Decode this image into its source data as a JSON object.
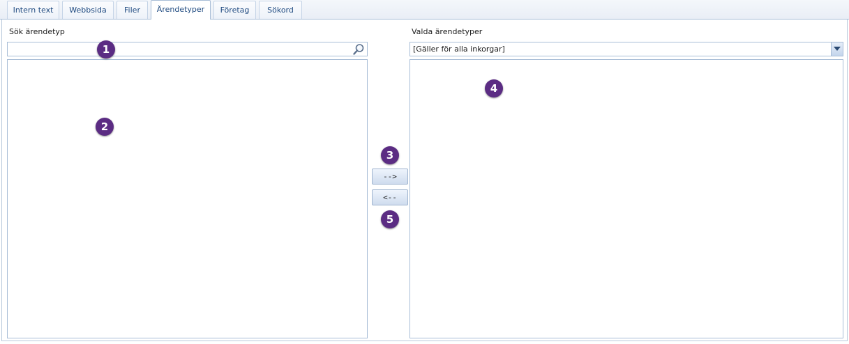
{
  "tabs": [
    {
      "label": "Intern text",
      "active": false
    },
    {
      "label": "Webbsida",
      "active": false
    },
    {
      "label": "Filer",
      "active": false
    },
    {
      "label": "Ärendetyper",
      "active": true
    },
    {
      "label": "Företag",
      "active": false
    },
    {
      "label": "Sökord",
      "active": false
    }
  ],
  "left_panel": {
    "label": "Sök ärendetyp",
    "search_value": "",
    "search_icon": "search-icon",
    "items": []
  },
  "right_panel": {
    "label": "Valda ärendetyper",
    "inbox_selected": "[Gäller för alla inkorgar]",
    "items": []
  },
  "buttons": {
    "add_label": "-->",
    "remove_label": "<--"
  },
  "callouts": [
    "1",
    "2",
    "3",
    "4",
    "5"
  ],
  "colors": {
    "callout": "#5b2c83",
    "accent_border": "#a7bcd6",
    "tab_text": "#1f4a80"
  }
}
